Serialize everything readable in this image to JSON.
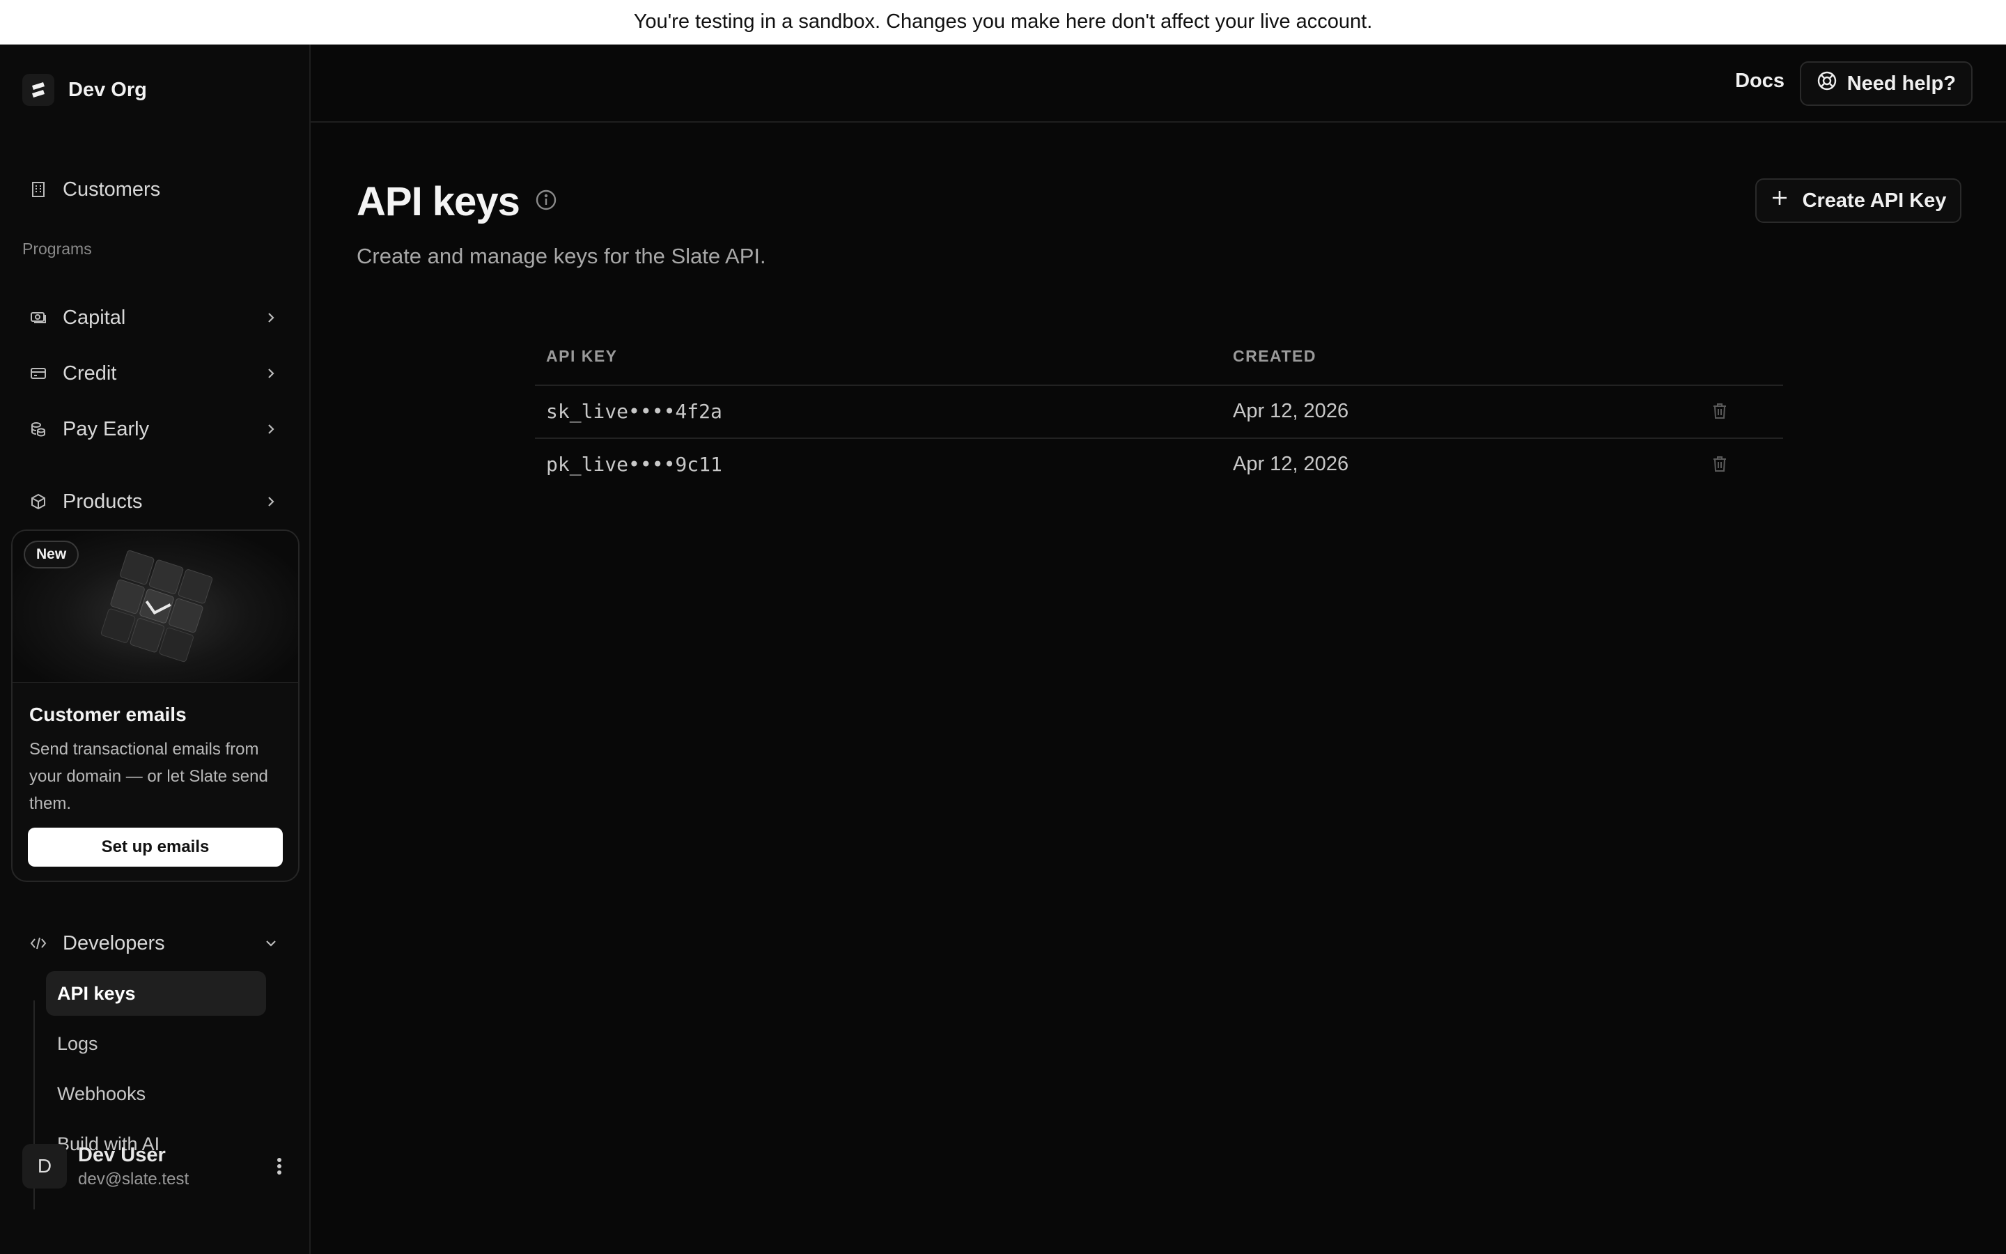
{
  "banner": {
    "text": "You're testing in a sandbox. Changes you make here don't affect your live account."
  },
  "sidebar": {
    "org_name": "Dev Org",
    "customers": "Customers",
    "programs_label": "Programs",
    "programs": [
      {
        "label": "Capital"
      },
      {
        "label": "Credit"
      },
      {
        "label": "Pay Early"
      }
    ],
    "products": "Products",
    "promo": {
      "badge": "New",
      "title": "Customer emails",
      "description": "Send transactional emails from your domain — or let Slate send them.",
      "button": "Set up emails"
    },
    "developers": {
      "label": "Developers",
      "items": [
        {
          "label": "API keys",
          "active": true
        },
        {
          "label": "Logs"
        },
        {
          "label": "Webhooks"
        },
        {
          "label": "Build with AI"
        }
      ]
    },
    "user": {
      "initial": "D",
      "name": "Dev User",
      "email": "dev@slate.test"
    }
  },
  "topbar": {
    "docs": "Docs",
    "help": "Need help?"
  },
  "main": {
    "title": "API keys",
    "subtitle": "Create and manage keys for the Slate API.",
    "create_button": "Create API Key",
    "table": {
      "headers": [
        "API KEY",
        "CREATED"
      ],
      "rows": [
        {
          "key": "sk_live••••4f2a",
          "created": "Apr 12, 2026"
        },
        {
          "key": "pk_live••••9c11",
          "created": "Apr 12, 2026"
        }
      ]
    }
  }
}
